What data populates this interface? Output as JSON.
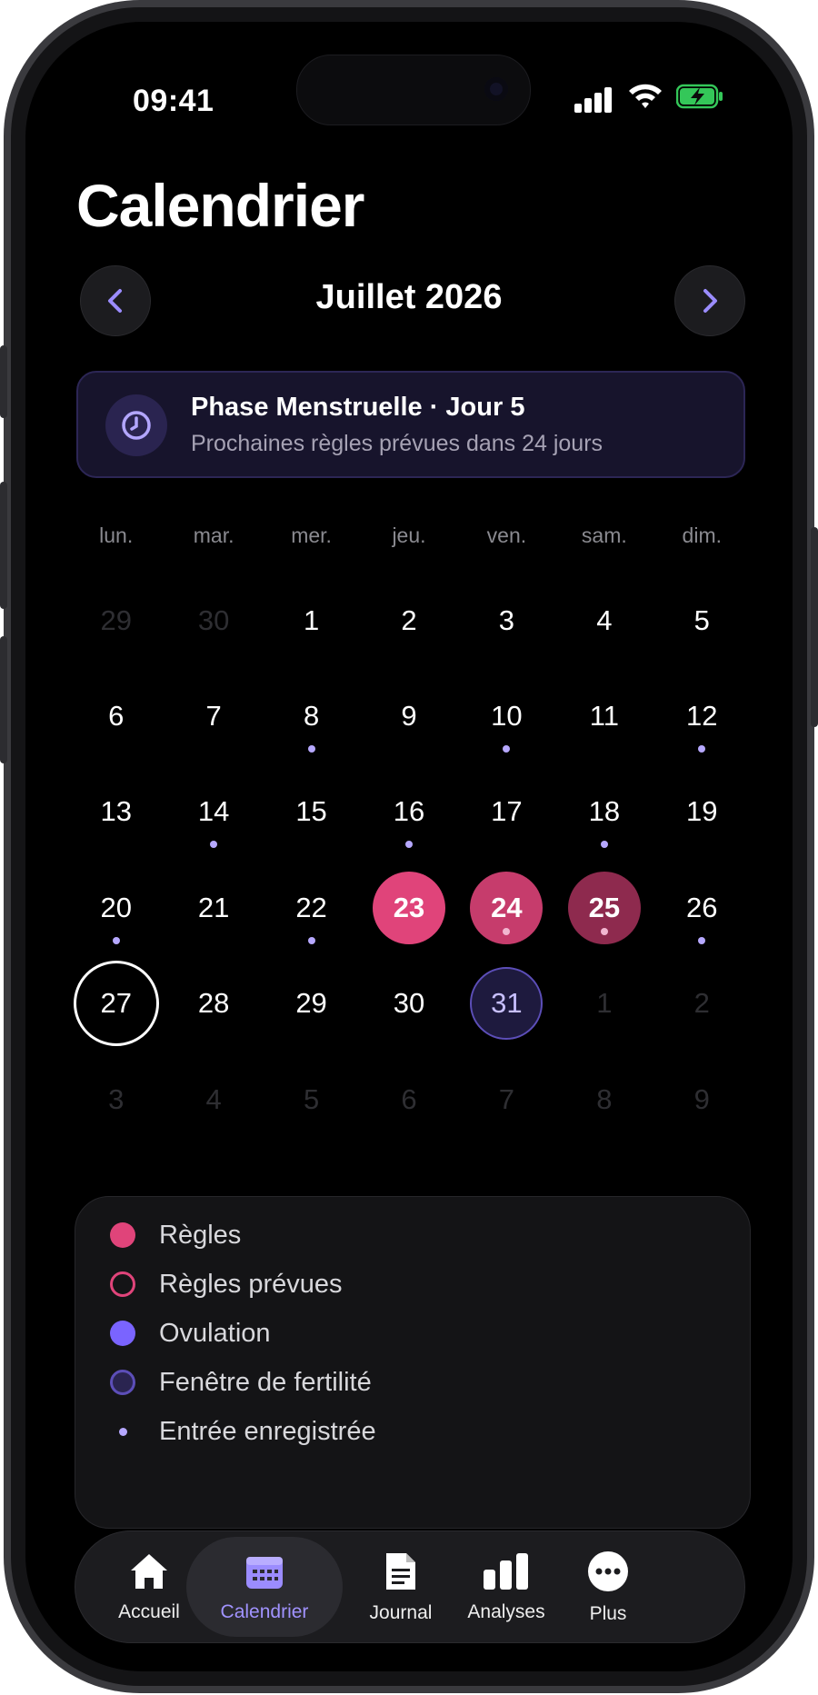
{
  "status": {
    "time": "09:41"
  },
  "header": {
    "title": "Calendrier"
  },
  "month_nav": {
    "month_label": "Juillet 2026"
  },
  "phase_card": {
    "title": "Phase Menstruelle · Jour 5",
    "subtitle": "Prochaines règles prévues dans 24 jours"
  },
  "weekdays": [
    "lun.",
    "mar.",
    "mer.",
    "jeu.",
    "ven.",
    "sam.",
    "dim."
  ],
  "days": [
    {
      "n": "29",
      "state": "other",
      "dot": false
    },
    {
      "n": "30",
      "state": "other",
      "dot": false
    },
    {
      "n": "1",
      "state": "normal",
      "dot": false
    },
    {
      "n": "2",
      "state": "normal",
      "dot": false
    },
    {
      "n": "3",
      "state": "normal",
      "dot": false
    },
    {
      "n": "4",
      "state": "normal",
      "dot": false
    },
    {
      "n": "5",
      "state": "normal",
      "dot": false
    },
    {
      "n": "6",
      "state": "normal",
      "dot": false
    },
    {
      "n": "7",
      "state": "normal",
      "dot": false
    },
    {
      "n": "8",
      "state": "normal",
      "dot": true
    },
    {
      "n": "9",
      "state": "normal",
      "dot": false
    },
    {
      "n": "10",
      "state": "normal",
      "dot": true
    },
    {
      "n": "11",
      "state": "normal",
      "dot": false
    },
    {
      "n": "12",
      "state": "normal",
      "dot": true
    },
    {
      "n": "13",
      "state": "normal",
      "dot": false
    },
    {
      "n": "14",
      "state": "normal",
      "dot": true
    },
    {
      "n": "15",
      "state": "normal",
      "dot": false
    },
    {
      "n": "16",
      "state": "normal",
      "dot": true
    },
    {
      "n": "17",
      "state": "normal",
      "dot": false
    },
    {
      "n": "18",
      "state": "normal",
      "dot": true
    },
    {
      "n": "19",
      "state": "normal",
      "dot": false
    },
    {
      "n": "20",
      "state": "normal",
      "dot": true
    },
    {
      "n": "21",
      "state": "normal",
      "dot": false
    },
    {
      "n": "22",
      "state": "normal",
      "dot": true
    },
    {
      "n": "23",
      "state": "period",
      "dot": false
    },
    {
      "n": "24",
      "state": "period-darker",
      "dot": true
    },
    {
      "n": "25",
      "state": "period-darkest",
      "dot": true
    },
    {
      "n": "26",
      "state": "normal",
      "dot": true
    },
    {
      "n": "27",
      "state": "today",
      "dot": false
    },
    {
      "n": "28",
      "state": "normal",
      "dot": false
    },
    {
      "n": "29",
      "state": "normal",
      "dot": false
    },
    {
      "n": "30",
      "state": "normal",
      "dot": false
    },
    {
      "n": "31",
      "state": "fertile",
      "dot": false
    },
    {
      "n": "1",
      "state": "other",
      "dot": false
    },
    {
      "n": "2",
      "state": "other",
      "dot": false
    },
    {
      "n": "3",
      "state": "other",
      "dot": false
    },
    {
      "n": "4",
      "state": "other",
      "dot": false
    },
    {
      "n": "5",
      "state": "other",
      "dot": false
    },
    {
      "n": "6",
      "state": "other",
      "dot": false
    },
    {
      "n": "7",
      "state": "other",
      "dot": false
    },
    {
      "n": "8",
      "state": "other",
      "dot": false
    },
    {
      "n": "9",
      "state": "other",
      "dot": false
    }
  ],
  "legend": [
    {
      "label": "Règles",
      "kind": "period"
    },
    {
      "label": "Règles prévues",
      "kind": "predicted"
    },
    {
      "label": "Ovulation",
      "kind": "ovulation"
    },
    {
      "label": "Fenêtre de fertilité",
      "kind": "fertile"
    },
    {
      "label": "Entrée enregistrée",
      "kind": "entry"
    }
  ],
  "tabs": [
    {
      "label": "Accueil",
      "icon": "home-icon",
      "active": false
    },
    {
      "label": "Calendrier",
      "icon": "calendar-icon",
      "active": true
    },
    {
      "label": "Journal",
      "icon": "document-icon",
      "active": false
    },
    {
      "label": "Analyses",
      "icon": "bar-chart-icon",
      "active": false
    },
    {
      "label": "Plus",
      "icon": "more-icon",
      "active": false
    }
  ],
  "colors": {
    "accent": "#9b8cff",
    "period": "#e0447a",
    "ovulation": "#7a64ff",
    "fertile": "#5c4eb8"
  }
}
